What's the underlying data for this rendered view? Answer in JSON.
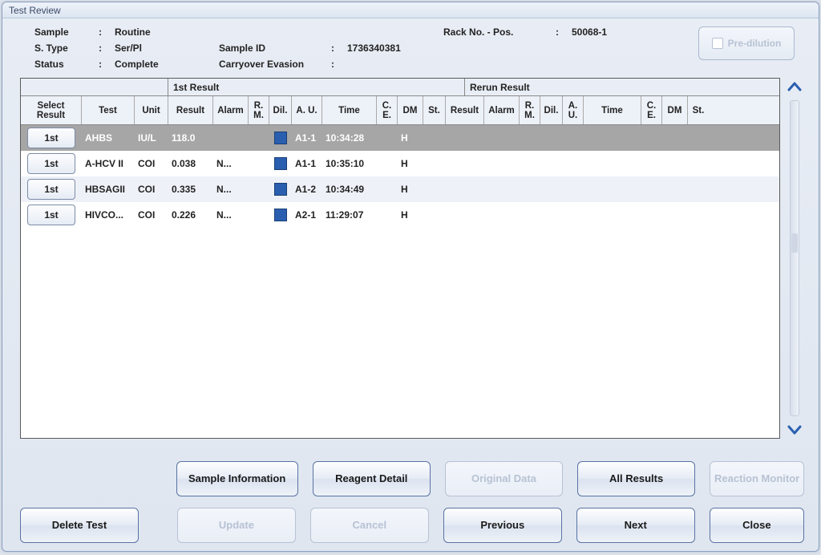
{
  "window_title": "Test Review",
  "header": {
    "labels": {
      "sample": "Sample",
      "s_type": "S. Type",
      "status": "Status",
      "sample_id": "Sample ID",
      "carryover": "Carryover Evasion",
      "rack": "Rack No. - Pos."
    },
    "sep": ":",
    "values": {
      "sample": "Routine",
      "s_type": "Ser/Pl",
      "status": "Complete",
      "sample_id": "1736340381",
      "carryover": "",
      "rack": "50068-1"
    },
    "predilution": "Pre-dilution"
  },
  "sections": {
    "first": "1st Result",
    "rerun": "Rerun Result",
    "select_result": "Select Result"
  },
  "columns": {
    "test": "Test",
    "unit": "Unit",
    "result": "Result",
    "alarm": "Alarm",
    "rm": "R. M.",
    "dil": "Dil.",
    "au": "A. U.",
    "time": "Time",
    "ce": "C. E.",
    "dm": "DM",
    "st": "St."
  },
  "rows": [
    {
      "select": "1st",
      "test": "AHBS",
      "unit": "IU/L",
      "result": "118.0",
      "alarm": "",
      "rm": "",
      "au": "A1-1",
      "time": "10:34:28",
      "ce": "",
      "dm": "H",
      "st": "",
      "style": "selected"
    },
    {
      "select": "1st",
      "test": "A-HCV II",
      "unit": "COI",
      "result": "0.038",
      "alarm": "N...",
      "rm": "",
      "au": "A1-1",
      "time": "10:35:10",
      "ce": "",
      "dm": "H",
      "st": "",
      "style": "odd"
    },
    {
      "select": "1st",
      "test": "HBSAGII",
      "unit": "COI",
      "result": "0.335",
      "alarm": "N...",
      "rm": "",
      "au": "A1-2",
      "time": "10:34:49",
      "ce": "",
      "dm": "H",
      "st": "",
      "style": "even"
    },
    {
      "select": "1st",
      "test": "HIVCO...",
      "unit": "COI",
      "result": "0.226",
      "alarm": "N...",
      "rm": "",
      "au": "A2-1",
      "time": "11:29:07",
      "ce": "",
      "dm": "H",
      "st": "",
      "style": "odd"
    }
  ],
  "buttons": {
    "sample_info": "Sample Information",
    "reagent_detail": "Reagent Detail",
    "original_data": "Original Data",
    "all_results": "All Results",
    "reaction_monitor": "Reaction Monitor",
    "delete_test": "Delete Test",
    "update": "Update",
    "cancel": "Cancel",
    "previous": "Previous",
    "next": "Next",
    "close": "Close"
  }
}
